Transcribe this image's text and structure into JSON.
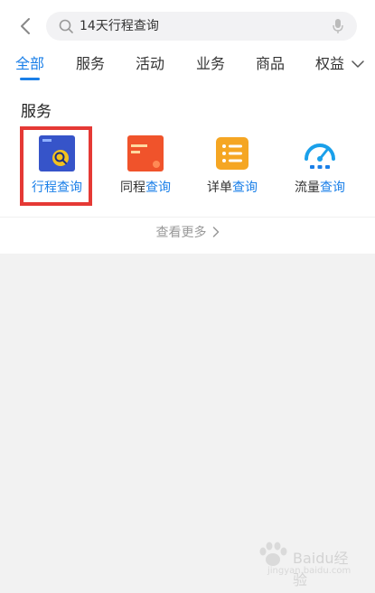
{
  "search": {
    "query": "14天行程查询"
  },
  "tabs": [
    {
      "label": "全部"
    },
    {
      "label": "服务"
    },
    {
      "label": "活动"
    },
    {
      "label": "业务"
    },
    {
      "label": "商品"
    },
    {
      "label": "权益"
    }
  ],
  "section": {
    "title": "服务"
  },
  "services": [
    {
      "part_a": "行程",
      "part_b": "查询",
      "icon": "trip-query-icon"
    },
    {
      "part_a": "同程",
      "part_b": "查询",
      "icon": "same-trip-query-icon"
    },
    {
      "part_a": "详单",
      "part_b": "查询",
      "icon": "bill-detail-icon"
    },
    {
      "part_a": "流量",
      "part_b": "查询",
      "icon": "data-usage-gauge-icon"
    }
  ],
  "more": {
    "label": "查看更多"
  },
  "watermark": {
    "text": "Baidu经验",
    "sub": "jingyan.baidu.com"
  },
  "colors": {
    "accent": "#1a7fe8",
    "highlight": "#e53935",
    "background": "#f2f2f2"
  }
}
